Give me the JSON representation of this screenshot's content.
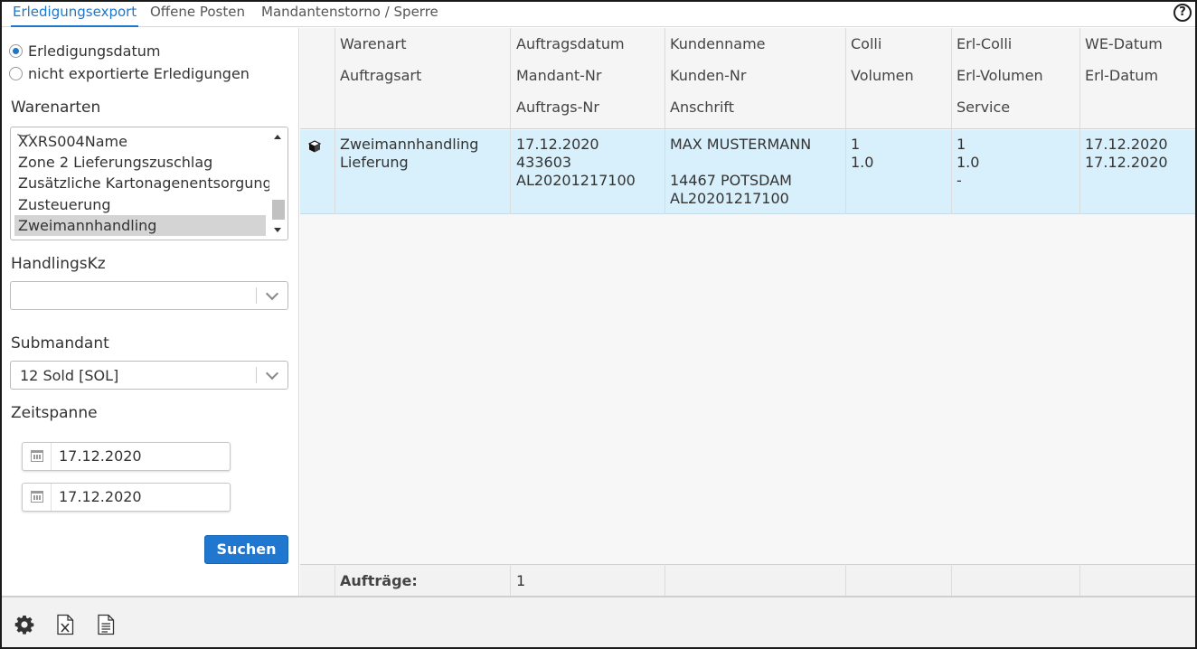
{
  "tabs": [
    {
      "label": "Erledigungsexport",
      "active": true
    },
    {
      "label": "Offene Posten",
      "active": false
    },
    {
      "label": "Mandantenstorno / Sperre",
      "active": false
    }
  ],
  "help_icon": "?",
  "filters": {
    "radio_options": [
      {
        "label": "Erledigungsdatum",
        "checked": true
      },
      {
        "label": "nicht exportierte Erledigungen",
        "checked": false
      }
    ],
    "warenarten_label": "Warenarten",
    "warenarten_items": [
      "XXRS004Name",
      "Zone 2 Lieferungszuschlag",
      "Zusätzliche Kartonagenentsorgung",
      "Zusteuerung",
      "Zweimannhandling"
    ],
    "warenarten_selected": "Zweimannhandling",
    "handlingskz_label": "HandlingsKz",
    "handlingskz_value": "",
    "submandant_label": "Submandant",
    "submandant_value": "12 Sold [SOL]",
    "zeitspanne_label": "Zeitspanne",
    "date_from": "17.12.2020",
    "date_to": "17.12.2020",
    "search_button": "Suchen"
  },
  "grid": {
    "columns": [
      {
        "lines": [
          "Warenart",
          "Auftragsart"
        ]
      },
      {
        "lines": [
          "Auftragsdatum",
          "Mandant-Nr",
          "Auftrags-Nr"
        ]
      },
      {
        "lines": [
          "Kundenname",
          "Kunden-Nr",
          "Anschrift"
        ]
      },
      {
        "lines": [
          "Colli",
          "Volumen"
        ]
      },
      {
        "lines": [
          "Erl-Colli",
          "Erl-Volumen",
          "Service"
        ]
      },
      {
        "lines": [
          "WE-Datum",
          "Erl-Datum"
        ]
      }
    ],
    "rows": [
      {
        "icon": "box-icon",
        "cells": [
          [
            "Zweimannhandling",
            "Lieferung"
          ],
          [
            "17.12.2020",
            "433603",
            "AL20201217100"
          ],
          [
            "MAX MUSTERMANN",
            "",
            "14467 POTSDAM",
            "AL20201217100"
          ],
          [
            "1",
            "1.0"
          ],
          [
            "1",
            "1.0",
            "-"
          ],
          [
            "17.12.2020",
            "17.12.2020"
          ]
        ]
      }
    ],
    "footer_label": "Aufträge:",
    "footer_value": "1"
  },
  "toolbar": {
    "icons": [
      "settings-gear-icon",
      "excel-export-icon",
      "document-export-icon"
    ]
  },
  "colors": {
    "accent": "#1f77c9",
    "selected_row": "#d8f0fb",
    "button": "#1f77d0"
  }
}
